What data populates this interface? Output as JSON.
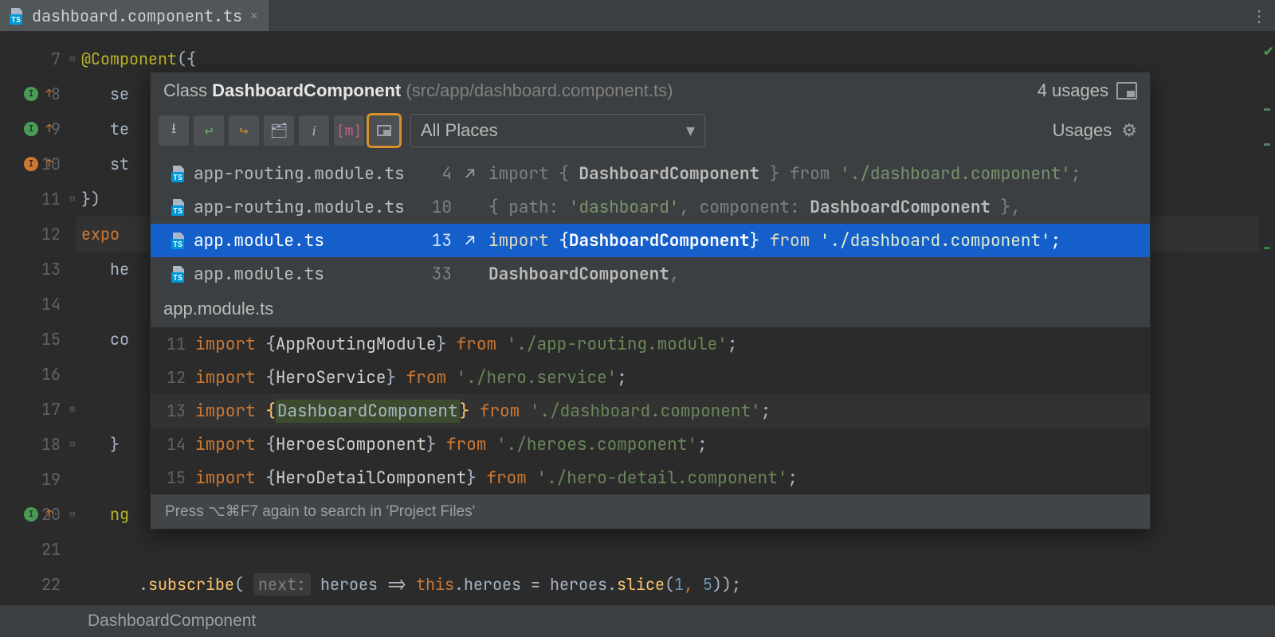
{
  "tab": {
    "filename": "dashboard.component.ts"
  },
  "editor": {
    "lines": [
      {
        "n": "7",
        "fold": "⊟",
        "mark": null,
        "html": "<span class='ann'>@Component</span><span class='ident'>({</span>"
      },
      {
        "n": "8",
        "mark": "green",
        "arrow": "↑",
        "html": "   <span class='ident'>se</span>"
      },
      {
        "n": "9",
        "mark": "green",
        "arrow": "↑",
        "html": "   <span class='ident'>te</span>"
      },
      {
        "n": "10",
        "mark": "orange",
        "arrow": "↑",
        "html": "   <span class='ident'>st</span>"
      },
      {
        "n": "11",
        "fold": "⊟",
        "html": "<span class='ident'>})</span>"
      },
      {
        "n": "12",
        "hl": true,
        "html": "<span class='kw'>expo</span>"
      },
      {
        "n": "13",
        "html": "   <span class='ident'>he</span>"
      },
      {
        "n": "14",
        "html": ""
      },
      {
        "n": "15",
        "html": "   <span class='ident'>co</span>"
      },
      {
        "n": "16",
        "html": "   <span class='ident'> </span>"
      },
      {
        "n": "17",
        "fold": "⊞",
        "html": "   <span class='ident'> </span>"
      },
      {
        "n": "18",
        "fold": "⊟",
        "html": "   <span class='ident'>}</span>"
      },
      {
        "n": "19",
        "html": ""
      },
      {
        "n": "20",
        "mark": "green",
        "arrow": "↑",
        "fold": "⊟",
        "html": "   <span class='ann'>ng</span>"
      },
      {
        "n": "21",
        "html": ""
      },
      {
        "n": "22",
        "html": "      <span class='ident'>.</span><span class='fn'>subscribe</span><span class='ident'>( </span><span class='param'>next:</span><span class='ident'> heroes =&gt; </span><span class='kw'>this</span><span class='ident'>.heroes = heroes.</span><span class='fn'>slice</span><span class='ident'>(</span><span class='num'>1</span><span class='comma'>,</span><span class='ident'> </span><span class='num'>5</span><span class='ident'>));</span>"
      }
    ]
  },
  "popup": {
    "kindLabel": "Class",
    "symbolName": "DashboardComponent",
    "sourcePath": "(src/app/dashboard.component.ts)",
    "usagesCount": "4 usages",
    "scope": "All Places",
    "usagesLabel": "Usages",
    "rows": [
      {
        "file": "app-routing.module.ts",
        "line": "4",
        "jump": true,
        "selected": false,
        "html": "<span class='ukw'>import</span> { <span class='ub'>DashboardComponent</span> } <span class='ukw'>from</span> <span class='us'>'./dashboard.component'</span>;"
      },
      {
        "file": "app-routing.module.ts",
        "line": "10",
        "jump": false,
        "selected": false,
        "html": "{ path: <span class='us'>'dashboard'</span>, component: <span class='ub'>DashboardComponent</span> },"
      },
      {
        "file": "app.module.ts",
        "line": "13",
        "jump": true,
        "selected": true,
        "html": "<span class='ukw'>import</span> {<span class='ub'>DashboardComponent</span>} <span class='ukw'>from</span> <span class='us'>'./dashboard.component'</span>;"
      },
      {
        "file": "app.module.ts",
        "line": "33",
        "jump": false,
        "selected": false,
        "html": "<span class='ub'>DashboardComponent</span>,"
      }
    ],
    "previewFile": "app.module.ts",
    "preview": [
      {
        "n": "11",
        "hl": false,
        "html": "<span class='kw'>import</span> <span class='br'>{</span><span class='id'>AppRoutingModule</span><span class='br'>}</span> <span class='kw'>from</span> <span class='str'>'./app-routing.module'</span><span class='br'>;</span>"
      },
      {
        "n": "12",
        "hl": false,
        "html": "<span class='kw'>import</span> <span class='br'>{</span><span class='id'>HeroService</span><span class='br'>}</span> <span class='kw'>from</span> <span class='str'>'./hero.service'</span><span class='br'>;</span>"
      },
      {
        "n": "13",
        "hl": true,
        "html": "<span class='kw'>import</span> <span class='occbr'>{</span><span class='occ'>DashboardComponent</span><span class='occbr'>}</span> <span class='kw'>from</span> <span class='str'>'./dashboard.component'</span><span class='br'>;</span>"
      },
      {
        "n": "14",
        "hl": false,
        "html": "<span class='kw'>import</span> <span class='br'>{</span><span class='id'>HeroesComponent</span><span class='br'>}</span> <span class='kw'>from</span> <span class='str'>'./heroes.component'</span><span class='br'>;</span>"
      },
      {
        "n": "15",
        "hl": false,
        "html": "<span class='kw'>import</span> <span class='br'>{</span><span class='id'>HeroDetailComponent</span><span class='br'>}</span> <span class='kw'>from</span> <span class='str'>'./hero-detail.component'</span><span class='br'>;</span>"
      }
    ],
    "hint": "Press ⌥⌘F7 again to search in 'Project Files'"
  },
  "status": {
    "text": "DashboardComponent"
  }
}
